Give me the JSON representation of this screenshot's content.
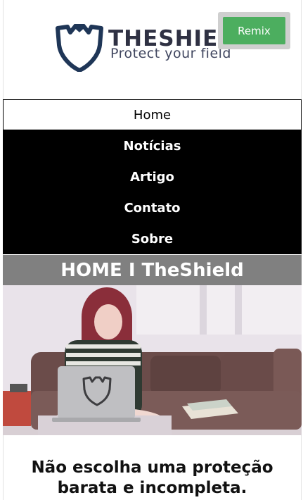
{
  "header": {
    "logo_word": "THESHIELD",
    "logo_tagline": "Protect your field",
    "remix_label": "Remix"
  },
  "nav": {
    "items": [
      {
        "label": "Home",
        "active": true
      },
      {
        "label": "Notícias",
        "active": false
      },
      {
        "label": "Artigo",
        "active": false
      },
      {
        "label": "Contato",
        "active": false
      },
      {
        "label": "Sobre",
        "active": false
      }
    ]
  },
  "main": {
    "page_title": "HOME I TheShield",
    "tagline_line1": "Não escolha uma proteção",
    "tagline_line2": "barata e incompleta."
  },
  "colors": {
    "brand_dark": "#2f3143",
    "remix_green": "#4cae5f",
    "nav_bg": "#000000",
    "title_bar": "#808080"
  },
  "icons": {
    "logo": "shield-icon",
    "laptop_logo": "shield-icon"
  }
}
